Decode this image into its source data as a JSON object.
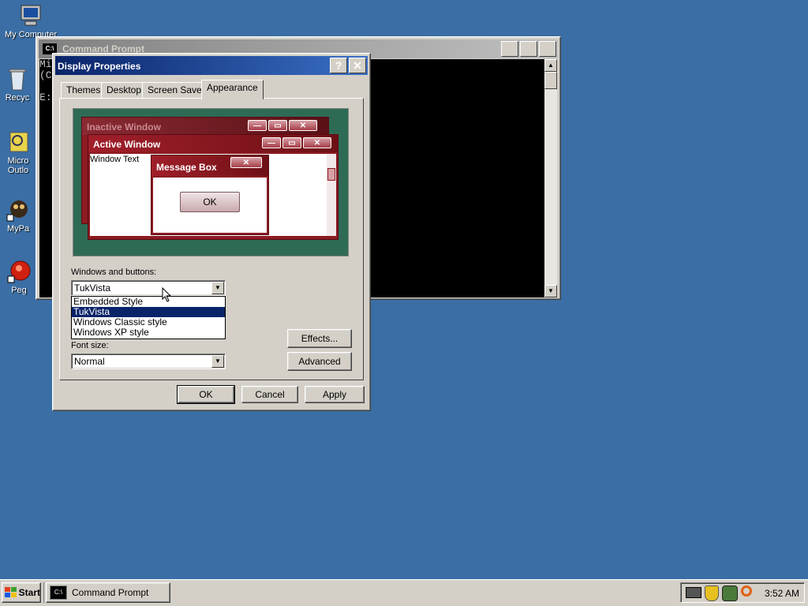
{
  "desktop": {
    "icons": [
      {
        "label": "My Computer",
        "icon": "my-computer-icon"
      },
      {
        "label": "Recyc",
        "icon": "recycle-bin-icon"
      },
      {
        "label": "Micro",
        "label2": "Outlo",
        "icon": "outlook-icon"
      },
      {
        "label": "MyPa",
        "icon": "mypal-icon"
      },
      {
        "label": "Peg",
        "icon": "pegasus-icon"
      }
    ]
  },
  "cmd_window": {
    "title": "Command Prompt",
    "icon_text": "C:\\",
    "console_lines": [
      "Mi",
      "(C",
      "",
      "E:"
    ]
  },
  "dialog": {
    "title": "Display Properties",
    "help": "?",
    "close": "✕",
    "tabs": [
      "Themes",
      "Desktop",
      "Screen Saver",
      "Appearance"
    ],
    "preview": {
      "inactive_title": "Inactive Window",
      "active_title": "Active Window",
      "window_text": "Window Text",
      "message_title": "Message Box",
      "ok": "OK"
    },
    "windows_buttons_label": "Windows and buttons:",
    "windows_buttons_value": "TukVista",
    "style_options": [
      "Embedded Style",
      "TukVista",
      "Windows Classic style",
      "Windows XP style"
    ],
    "selected_option": "TukVista",
    "font_size_label": "Font size:",
    "font_size_value": "Normal",
    "effects_label": "Effects...",
    "advanced_label": "Advanced",
    "ok_label": "OK",
    "cancel_label": "Cancel",
    "apply_label": "Apply"
  },
  "taskbar": {
    "start_label": "Start",
    "tasks": [
      {
        "label": "Command Prompt",
        "icon_text": "C:\\"
      }
    ],
    "clock": "3:52 AM"
  },
  "colors": {
    "desktop": "#3a6ea5",
    "active_title": "#0a246a",
    "preview_bg": "#2e6b55",
    "preview_window": "#8c1b22"
  }
}
